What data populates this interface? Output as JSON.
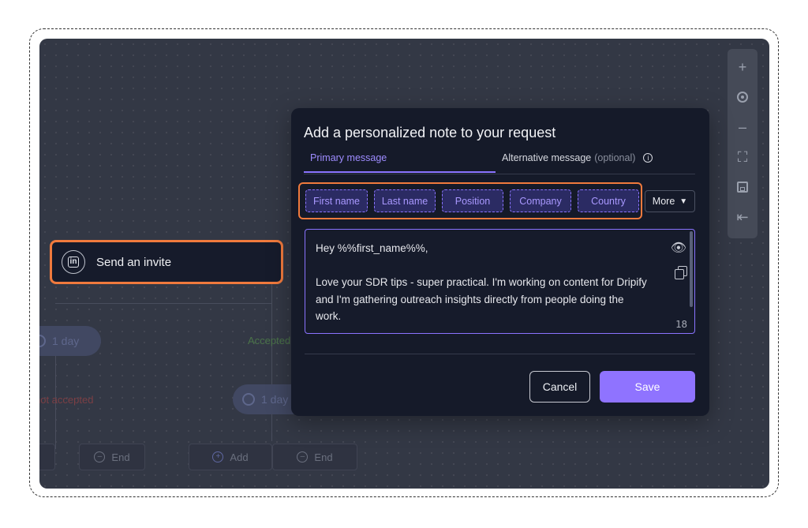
{
  "modal": {
    "title": "Add a personalized note to your request",
    "tabs": {
      "primary": "Primary message",
      "alternative": "Alternative message",
      "alternative_suffix": "(optional)"
    },
    "variables": [
      "First name",
      "Last name",
      "Position",
      "Company",
      "Country"
    ],
    "more_label": "More",
    "message": "Hey %%first_name%%,\n\nLove your SDR tips - super practical. I'm working on content for Dripify and I'm gathering outreach insights directly from people doing the work.",
    "char_count": "18",
    "cancel_label": "Cancel",
    "save_label": "Save"
  },
  "invite_node": {
    "label": "Send an invite"
  },
  "flow": {
    "delay_left": "1 day",
    "delay_mid": "1 day",
    "accepted_label": "Accepted",
    "not_accepted_label": "not accepted",
    "end_left": "End",
    "add_label": "Add",
    "end_mid": "End"
  },
  "colors": {
    "accent": "#8f73ff",
    "highlight": "#f07a3d",
    "modal_bg": "#151a29",
    "canvas_bg": "#3a3f4c",
    "accepted": "#6fbf5a",
    "not_accepted": "#d9534f"
  },
  "toolbar_icons": [
    "plus-icon",
    "target-icon",
    "minus-icon",
    "fit-screen-icon",
    "save-icon",
    "exit-icon"
  ]
}
